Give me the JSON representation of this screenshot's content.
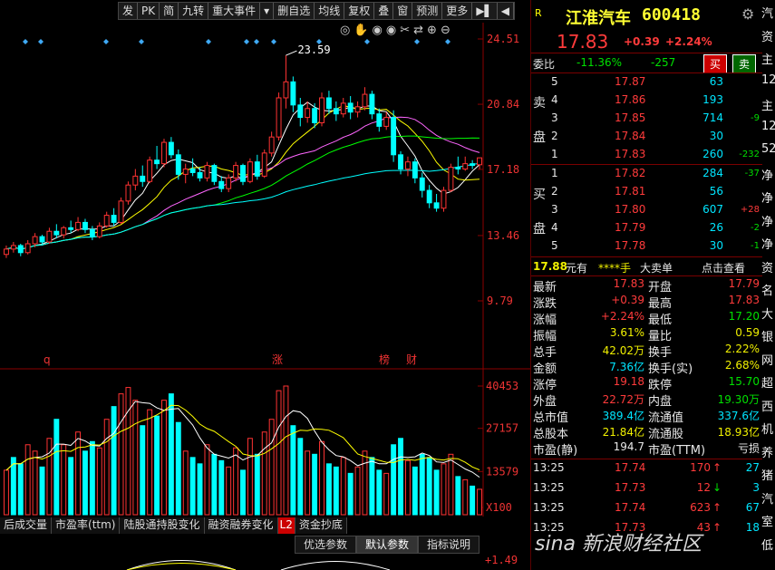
{
  "toolbar": [
    "发",
    "PK",
    "简",
    "九转",
    "重大事件",
    "▾",
    "删自选",
    "均线",
    "复权",
    "叠",
    "窗",
    "预测",
    "更多",
    "▶▌",
    "◀"
  ],
  "icon_names": [
    "zoom-reset-icon",
    "hand-icon",
    "back-icon",
    "forward-icon",
    "scissors-icon",
    "shuffle-icon",
    "zoom-in-icon",
    "zoom-out-icon"
  ],
  "stock": {
    "flag": "R",
    "name": "江淮汽车",
    "code": "600418",
    "price": "17.83",
    "change": "+0.39",
    "pct": "+2.24%"
  },
  "weibi": {
    "label": "委比",
    "pct": "-11.36%",
    "diff": "-257",
    "buy": "买",
    "sell": "卖"
  },
  "sell_side": "卖盘",
  "buy_side": "买盘",
  "asks": [
    {
      "lvl": "5",
      "price": "17.87",
      "vol": "63",
      "chg": ""
    },
    {
      "lvl": "4",
      "price": "17.86",
      "vol": "193",
      "chg": ""
    },
    {
      "lvl": "3",
      "price": "17.85",
      "vol": "714",
      "chg": "-9"
    },
    {
      "lvl": "2",
      "price": "17.84",
      "vol": "30",
      "chg": ""
    },
    {
      "lvl": "1",
      "price": "17.83",
      "vol": "260",
      "chg": "-232"
    }
  ],
  "bids": [
    {
      "lvl": "1",
      "price": "17.82",
      "vol": "284",
      "chg": "-37"
    },
    {
      "lvl": "2",
      "price": "17.81",
      "vol": "56",
      "chg": ""
    },
    {
      "lvl": "3",
      "price": "17.80",
      "vol": "607",
      "chg": "+28"
    },
    {
      "lvl": "4",
      "price": "17.79",
      "vol": "26",
      "chg": "-2"
    },
    {
      "lvl": "5",
      "price": "17.78",
      "vol": "30",
      "chg": "-1"
    }
  ],
  "bigorder": {
    "price": "17.88",
    "unit": "元有",
    "stars": "****手",
    "label": "大卖单",
    "link": "点击查看"
  },
  "stats": [
    {
      "k1": "最新",
      "v1": "17.83",
      "c1": "r",
      "k2": "开盘",
      "v2": "17.79",
      "c2": "r"
    },
    {
      "k1": "涨跌",
      "v1": "+0.39",
      "c1": "r",
      "k2": "最高",
      "v2": "17.83",
      "c2": "r"
    },
    {
      "k1": "涨幅",
      "v1": "+2.24%",
      "c1": "r",
      "k2": "最低",
      "v2": "17.20",
      "c2": "g"
    },
    {
      "k1": "振幅",
      "v1": "3.61%",
      "c1": "y",
      "k2": "量比",
      "v2": "0.59",
      "c2": "y"
    },
    {
      "k1": "总手",
      "v1": "42.02万",
      "c1": "y",
      "k2": "换手",
      "v2": "2.22%",
      "c2": "y"
    },
    {
      "k1": "金额",
      "v1": "7.36亿",
      "c1": "cy",
      "k2": "换手(实)",
      "v2": "2.68%",
      "c2": "y"
    },
    {
      "k1": "涨停",
      "v1": "19.18",
      "c1": "r",
      "k2": "跌停",
      "v2": "15.70",
      "c2": "g"
    },
    {
      "k1": "外盘",
      "v1": "22.72万",
      "c1": "r",
      "k2": "内盘",
      "v2": "19.30万",
      "c2": "g"
    },
    {
      "k1": "总市值",
      "v1": "389.4亿",
      "c1": "cy",
      "k2": "流通值",
      "v2": "337.6亿",
      "c2": "cy"
    },
    {
      "k1": "总股本",
      "v1": "21.84亿",
      "c1": "y",
      "k2": "流通股",
      "v2": "18.93亿",
      "c2": "y"
    },
    {
      "k1": "市盈(静)",
      "v1": "194.7",
      "c1": "w",
      "k2": "市盈(TTM)",
      "v2": "亏损",
      "c2": "w"
    }
  ],
  "ticks": [
    {
      "time": "13:25",
      "price": "17.74",
      "vol": "170",
      "dir": "up",
      "n": "27"
    },
    {
      "time": "13:25",
      "price": "17.73",
      "vol": "12",
      "dir": "down",
      "n": "3"
    },
    {
      "time": "13:25",
      "price": "17.74",
      "vol": "623",
      "dir": "up",
      "n": "67"
    },
    {
      "time": "13:25",
      "price": "17.73",
      "vol": "43",
      "dir": "up",
      "n": "18"
    }
  ],
  "edge_chars": [
    "汽",
    "资",
    "主",
    "12",
    "主",
    "12",
    "52",
    "净",
    "净",
    "净",
    "净",
    "资",
    "名",
    "大",
    "银",
    "网",
    "超",
    "西",
    "机",
    "养",
    "猪",
    "汽",
    "室",
    "低"
  ],
  "bottom_tabs": [
    "后成交量",
    "市盈率(ttm)",
    "陆股通持股变化",
    "融资融券变化",
    "L2",
    "资金抄底"
  ],
  "param_tabs": [
    "优选参数",
    "默认参数",
    "指标说明"
  ],
  "watermark": "sina 新浪财经社区",
  "chart_data": {
    "type": "candlestick",
    "price_ticks": [
      "24.51",
      "20.84",
      "17.18",
      "13.46",
      "9.79"
    ],
    "vol_ticks": [
      "40453",
      "27157",
      "13579",
      "X100"
    ],
    "sub_tick": "+1.49",
    "high_label": "23.59",
    "markers": [
      "q",
      "涨",
      "榜",
      "财"
    ],
    "colors": {
      "up": "#ff3333",
      "down": "#00ffff",
      "ma5": "#ffffff",
      "ma10": "#ffff00",
      "ma20": "#ff66ff",
      "ma30": "#00ff00",
      "ma60": "#00ffff"
    },
    "candles": [
      [
        12.4,
        12.9,
        12.2,
        12.7
      ],
      [
        12.7,
        13.1,
        12.5,
        12.9
      ],
      [
        12.9,
        13.0,
        12.3,
        12.5
      ],
      [
        12.5,
        13.2,
        12.4,
        13.0
      ],
      [
        13.0,
        13.6,
        12.8,
        13.4
      ],
      [
        13.4,
        13.5,
        12.9,
        13.1
      ],
      [
        13.1,
        13.9,
        13.0,
        13.7
      ],
      [
        13.7,
        14.1,
        13.3,
        13.5
      ],
      [
        13.5,
        14.0,
        13.3,
        13.9
      ],
      [
        13.9,
        14.3,
        13.6,
        13.8
      ],
      [
        13.8,
        14.5,
        13.7,
        14.2
      ],
      [
        14.2,
        14.4,
        13.6,
        13.8
      ],
      [
        13.8,
        14.0,
        13.2,
        13.4
      ],
      [
        13.4,
        14.2,
        13.3,
        14.0
      ],
      [
        14.0,
        14.8,
        13.9,
        14.6
      ],
      [
        14.6,
        15.0,
        14.0,
        14.2
      ],
      [
        14.2,
        15.6,
        14.1,
        15.4
      ],
      [
        15.4,
        16.5,
        15.2,
        16.3
      ],
      [
        16.3,
        17.2,
        16.0,
        16.8
      ],
      [
        16.8,
        17.4,
        16.2,
        16.5
      ],
      [
        16.5,
        17.9,
        16.4,
        17.7
      ],
      [
        17.7,
        18.5,
        17.2,
        17.5
      ],
      [
        17.5,
        18.9,
        17.3,
        18.7
      ],
      [
        18.7,
        19.0,
        17.8,
        18.0
      ],
      [
        18.0,
        18.3,
        16.6,
        16.9
      ],
      [
        16.9,
        17.5,
        16.4,
        17.2
      ],
      [
        17.2,
        17.8,
        16.8,
        17.0
      ],
      [
        17.0,
        17.3,
        16.5,
        16.7
      ],
      [
        16.7,
        17.6,
        16.5,
        17.4
      ],
      [
        17.4,
        17.5,
        16.3,
        16.5
      ],
      [
        16.5,
        16.8,
        15.9,
        16.1
      ],
      [
        16.1,
        16.9,
        15.9,
        16.7
      ],
      [
        16.7,
        17.6,
        16.5,
        17.4
      ],
      [
        17.4,
        17.5,
        16.3,
        16.5
      ],
      [
        16.5,
        17.8,
        16.4,
        17.6
      ],
      [
        17.6,
        18.0,
        16.6,
        16.8
      ],
      [
        16.8,
        18.3,
        16.7,
        18.1
      ],
      [
        18.1,
        19.3,
        17.9,
        19.0
      ],
      [
        19.0,
        21.5,
        18.8,
        21.2
      ],
      [
        21.2,
        23.59,
        20.6,
        22.1
      ],
      [
        22.1,
        22.4,
        20.4,
        20.8
      ],
      [
        20.8,
        21.2,
        19.6,
        20.1
      ],
      [
        20.1,
        21.0,
        19.8,
        20.6
      ],
      [
        20.6,
        20.9,
        19.5,
        19.8
      ],
      [
        19.8,
        21.5,
        19.6,
        21.2
      ],
      [
        21.2,
        21.6,
        20.3,
        20.6
      ],
      [
        20.6,
        21.0,
        19.9,
        20.3
      ],
      [
        20.3,
        21.2,
        20.1,
        20.9
      ],
      [
        20.9,
        21.3,
        20.0,
        20.4
      ],
      [
        20.4,
        21.0,
        20.1,
        20.7
      ],
      [
        20.7,
        21.8,
        20.5,
        21.4
      ],
      [
        21.4,
        21.6,
        20.0,
        20.3
      ],
      [
        20.3,
        20.6,
        19.3,
        19.6
      ],
      [
        19.6,
        20.4,
        19.4,
        20.1
      ],
      [
        20.1,
        20.5,
        17.6,
        18.0
      ],
      [
        18.0,
        18.2,
        16.9,
        17.2
      ],
      [
        17.2,
        17.9,
        16.8,
        17.6
      ],
      [
        17.6,
        17.8,
        16.4,
        16.7
      ],
      [
        16.7,
        17.0,
        15.6,
        16.0
      ],
      [
        16.0,
        16.3,
        15.0,
        15.3
      ],
      [
        15.3,
        15.8,
        14.8,
        15.0
      ],
      [
        15.0,
        16.2,
        14.8,
        16.0
      ],
      [
        16.0,
        17.5,
        15.9,
        17.3
      ],
      [
        17.3,
        17.9,
        16.9,
        17.2
      ],
      [
        17.2,
        17.9,
        17.1,
        17.5
      ],
      [
        17.5,
        17.7,
        17.2,
        17.4
      ],
      [
        17.44,
        17.83,
        17.2,
        17.83
      ]
    ],
    "volumes": [
      [
        14000,
        "u"
      ],
      [
        18000,
        "d"
      ],
      [
        16000,
        "d"
      ],
      [
        22000,
        "u"
      ],
      [
        20000,
        "u"
      ],
      [
        15000,
        "d"
      ],
      [
        24000,
        "u"
      ],
      [
        30000,
        "d"
      ],
      [
        22000,
        "u"
      ],
      [
        18000,
        "d"
      ],
      [
        26000,
        "u"
      ],
      [
        20000,
        "d"
      ],
      [
        23000,
        "d"
      ],
      [
        21000,
        "u"
      ],
      [
        30000,
        "u"
      ],
      [
        34000,
        "d"
      ],
      [
        38000,
        "u"
      ],
      [
        40000,
        "u"
      ],
      [
        36000,
        "u"
      ],
      [
        28000,
        "d"
      ],
      [
        33000,
        "u"
      ],
      [
        31000,
        "d"
      ],
      [
        36000,
        "u"
      ],
      [
        38000,
        "d"
      ],
      [
        29000,
        "d"
      ],
      [
        20000,
        "u"
      ],
      [
        18000,
        "d"
      ],
      [
        16000,
        "d"
      ],
      [
        22000,
        "u"
      ],
      [
        19000,
        "d"
      ],
      [
        17000,
        "d"
      ],
      [
        15000,
        "u"
      ],
      [
        21000,
        "u"
      ],
      [
        14000,
        "d"
      ],
      [
        24000,
        "u"
      ],
      [
        19000,
        "d"
      ],
      [
        26000,
        "u"
      ],
      [
        30000,
        "u"
      ],
      [
        39000,
        "u"
      ],
      [
        40453,
        "u"
      ],
      [
        28000,
        "d"
      ],
      [
        24000,
        "d"
      ],
      [
        20000,
        "u"
      ],
      [
        19000,
        "d"
      ],
      [
        23000,
        "u"
      ],
      [
        16000,
        "d"
      ],
      [
        15000,
        "d"
      ],
      [
        18000,
        "u"
      ],
      [
        13000,
        "d"
      ],
      [
        15000,
        "u"
      ],
      [
        20000,
        "u"
      ],
      [
        18000,
        "d"
      ],
      [
        14000,
        "d"
      ],
      [
        13000,
        "u"
      ],
      [
        22000,
        "d"
      ],
      [
        24000,
        "d"
      ],
      [
        17000,
        "u"
      ],
      [
        15000,
        "d"
      ],
      [
        19000,
        "d"
      ],
      [
        18000,
        "d"
      ],
      [
        14000,
        "d"
      ],
      [
        16000,
        "u"
      ],
      [
        19000,
        "u"
      ],
      [
        12000,
        "d"
      ],
      [
        11000,
        "u"
      ],
      [
        9000,
        "d"
      ],
      [
        8000,
        "u"
      ]
    ]
  }
}
